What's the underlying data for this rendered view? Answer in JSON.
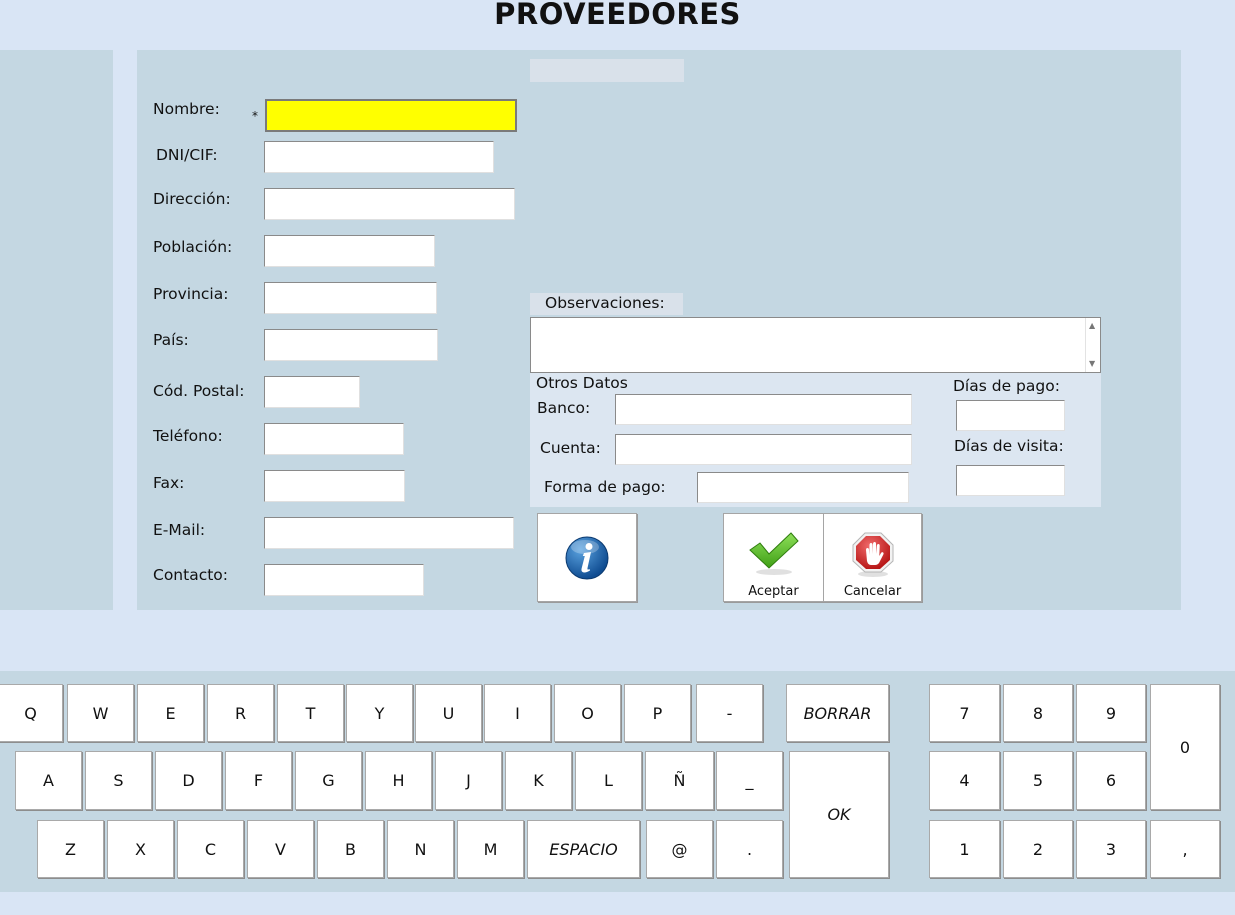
{
  "header": {
    "title": "PROVEEDORES"
  },
  "form": {
    "required_mark": "*",
    "fields": {
      "nombre": {
        "label": "Nombre:",
        "value": ""
      },
      "dni": {
        "label": "DNI/CIF:",
        "value": ""
      },
      "direccion": {
        "label": "Dirección:",
        "value": ""
      },
      "poblacion": {
        "label": "Población:",
        "value": ""
      },
      "provincia": {
        "label": "Provincia:",
        "value": ""
      },
      "pais": {
        "label": "País:",
        "value": ""
      },
      "cp": {
        "label": "Cód. Postal:",
        "value": ""
      },
      "telefono": {
        "label": "Teléfono:",
        "value": ""
      },
      "fax": {
        "label": "Fax:",
        "value": ""
      },
      "email": {
        "label": "E-Mail:",
        "value": ""
      },
      "contacto": {
        "label": "Contacto:",
        "value": ""
      }
    },
    "observaciones": {
      "label": "Observaciones:",
      "value": ""
    },
    "otros": {
      "title": "Otros Datos",
      "banco": {
        "label": "Banco:",
        "value": ""
      },
      "cuenta": {
        "label": "Cuenta:",
        "value": ""
      },
      "forma_pago": {
        "label": "Forma de pago:",
        "value": ""
      },
      "dias_pago": {
        "label": "Días de pago:",
        "value": ""
      },
      "dias_visita": {
        "label": "Días de visita:",
        "value": ""
      }
    }
  },
  "actions": {
    "info_icon": "info-icon",
    "accept_label": "Aceptar",
    "cancel_label": "Cancelar"
  },
  "keyboard": {
    "row1": [
      "Q",
      "W",
      "E",
      "R",
      "T",
      "Y",
      "U",
      "I",
      "O",
      "P",
      "-"
    ],
    "row2": [
      "A",
      "S",
      "D",
      "F",
      "G",
      "H",
      "J",
      "K",
      "L",
      "Ñ",
      "_"
    ],
    "row3": [
      "Z",
      "X",
      "C",
      "V",
      "B",
      "N",
      "M",
      "ESPACIO",
      "@",
      "."
    ],
    "borrar": "BORRAR",
    "ok": "OK",
    "numpad": {
      "row1": [
        "7",
        "8",
        "9"
      ],
      "row2": [
        "4",
        "5",
        "6"
      ],
      "row3": [
        "1",
        "2",
        "3"
      ],
      "zero": "0",
      "comma": ","
    }
  },
  "colors": {
    "background": "#d9e5f5",
    "panel": "#c4d7e2",
    "required_field": "#ffff00",
    "accept_green": "#4caf1d",
    "cancel_red": "#d42a2a",
    "info_blue": "#1e5fa8"
  }
}
